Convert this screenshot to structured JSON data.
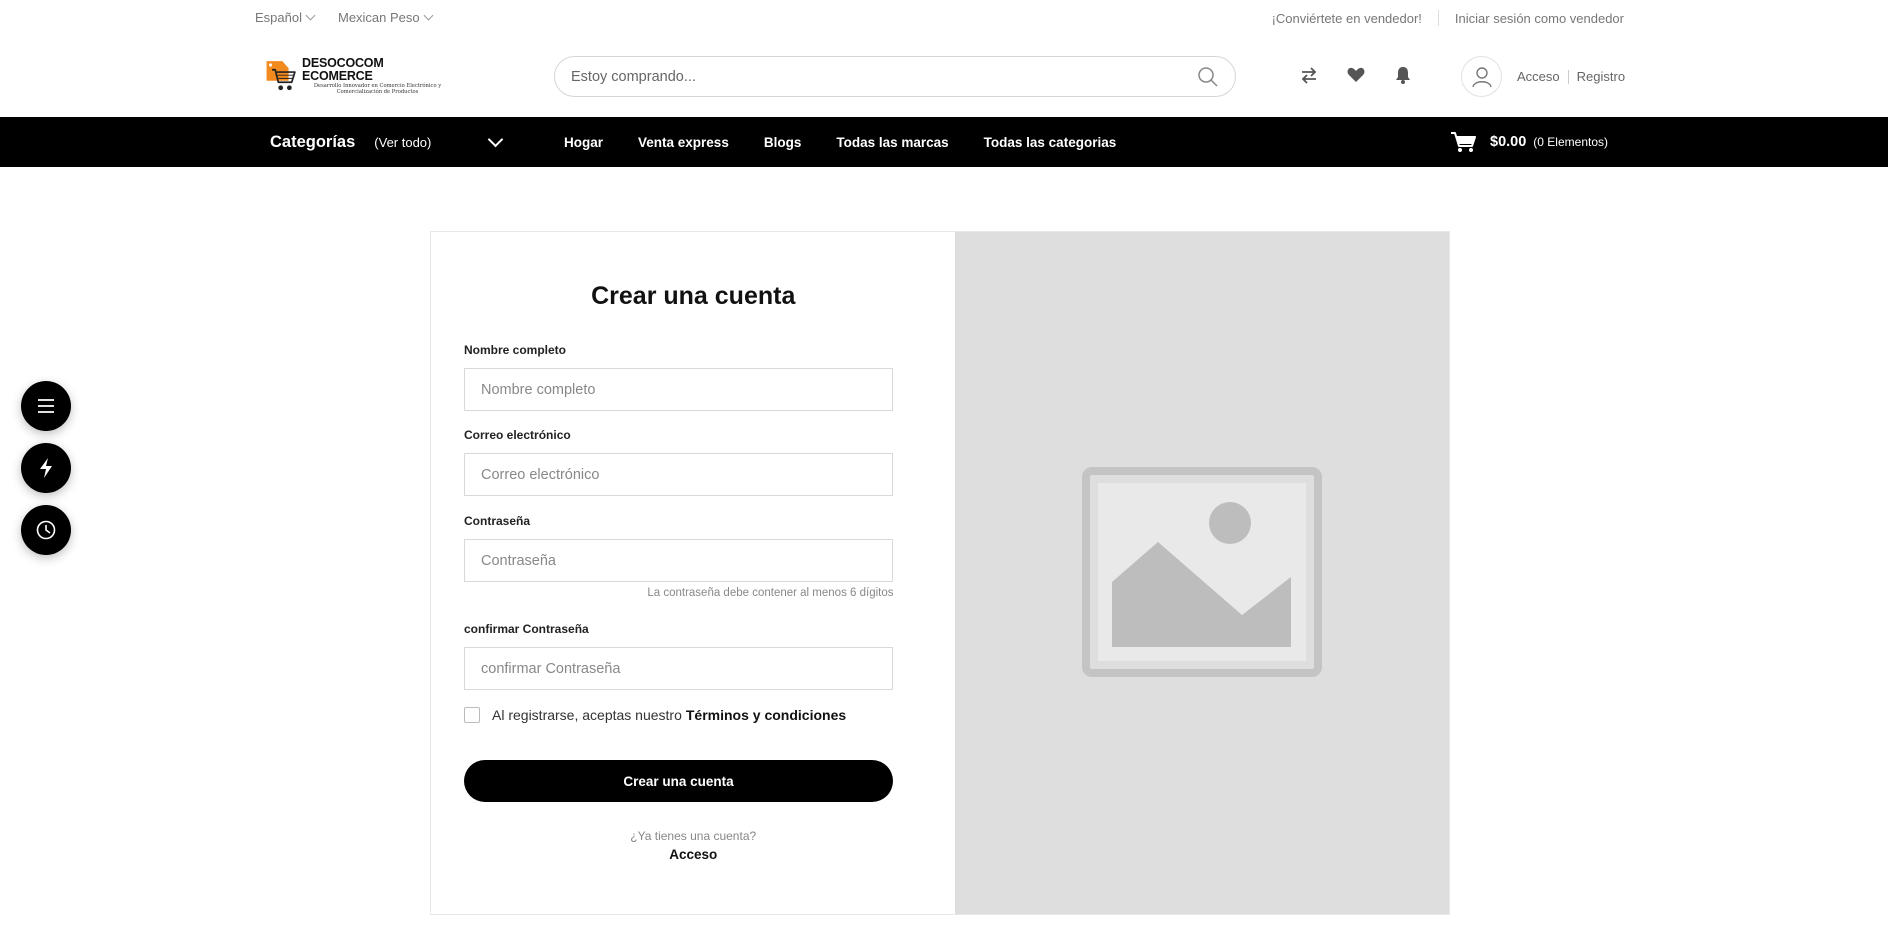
{
  "topbar": {
    "language": "Español",
    "currency": "Mexican Peso",
    "become_seller": "¡Conviértete en vendedor!",
    "seller_login": "Iniciar sesión como vendedor"
  },
  "header": {
    "logo_title": "DESOCOCOM ECOMERCE",
    "logo_subtitle": "Desarrollo Innovador en Comercio Electrónico y Comercialización de Productos",
    "search_placeholder": "Estoy comprando...",
    "icons": [
      "compare-icon",
      "heart-icon",
      "bell-icon",
      "user-icon",
      "search-icon",
      "cart-icon"
    ],
    "login_label": "Acceso",
    "register_label": "Registro"
  },
  "nav": {
    "categories_label": "Categorías",
    "view_all_label": "(Ver todo)",
    "menu": [
      "Hogar",
      "Venta express",
      "Blogs",
      "Todas las marcas",
      "Todas las categorias"
    ],
    "cart_total": "$0.00",
    "cart_items": "(0 Elementos)"
  },
  "form": {
    "title": "Crear una cuenta",
    "full_name_label": "Nombre completo",
    "full_name_placeholder": "Nombre completo",
    "email_label": "Correo electrónico",
    "email_placeholder": "Correo electrónico",
    "password_label": "Contraseña",
    "password_placeholder": "Contraseña",
    "password_hint": "La contraseña debe contener al menos 6 dígitos",
    "confirm_label": "confirmar Contraseña",
    "confirm_placeholder": "confirmar Contraseña",
    "terms_prefix": "Al registrarse, aceptas nuestro",
    "terms_link": "Términos y condiciones",
    "terms_checked": false,
    "submit_label": "Crear una cuenta",
    "have_account": "¿Ya tienes una cuenta?",
    "login_link": "Acceso"
  },
  "colors": {
    "primary": "#000000",
    "image_placeholder_bg": "#dedede",
    "border": "#d9d9d9"
  }
}
